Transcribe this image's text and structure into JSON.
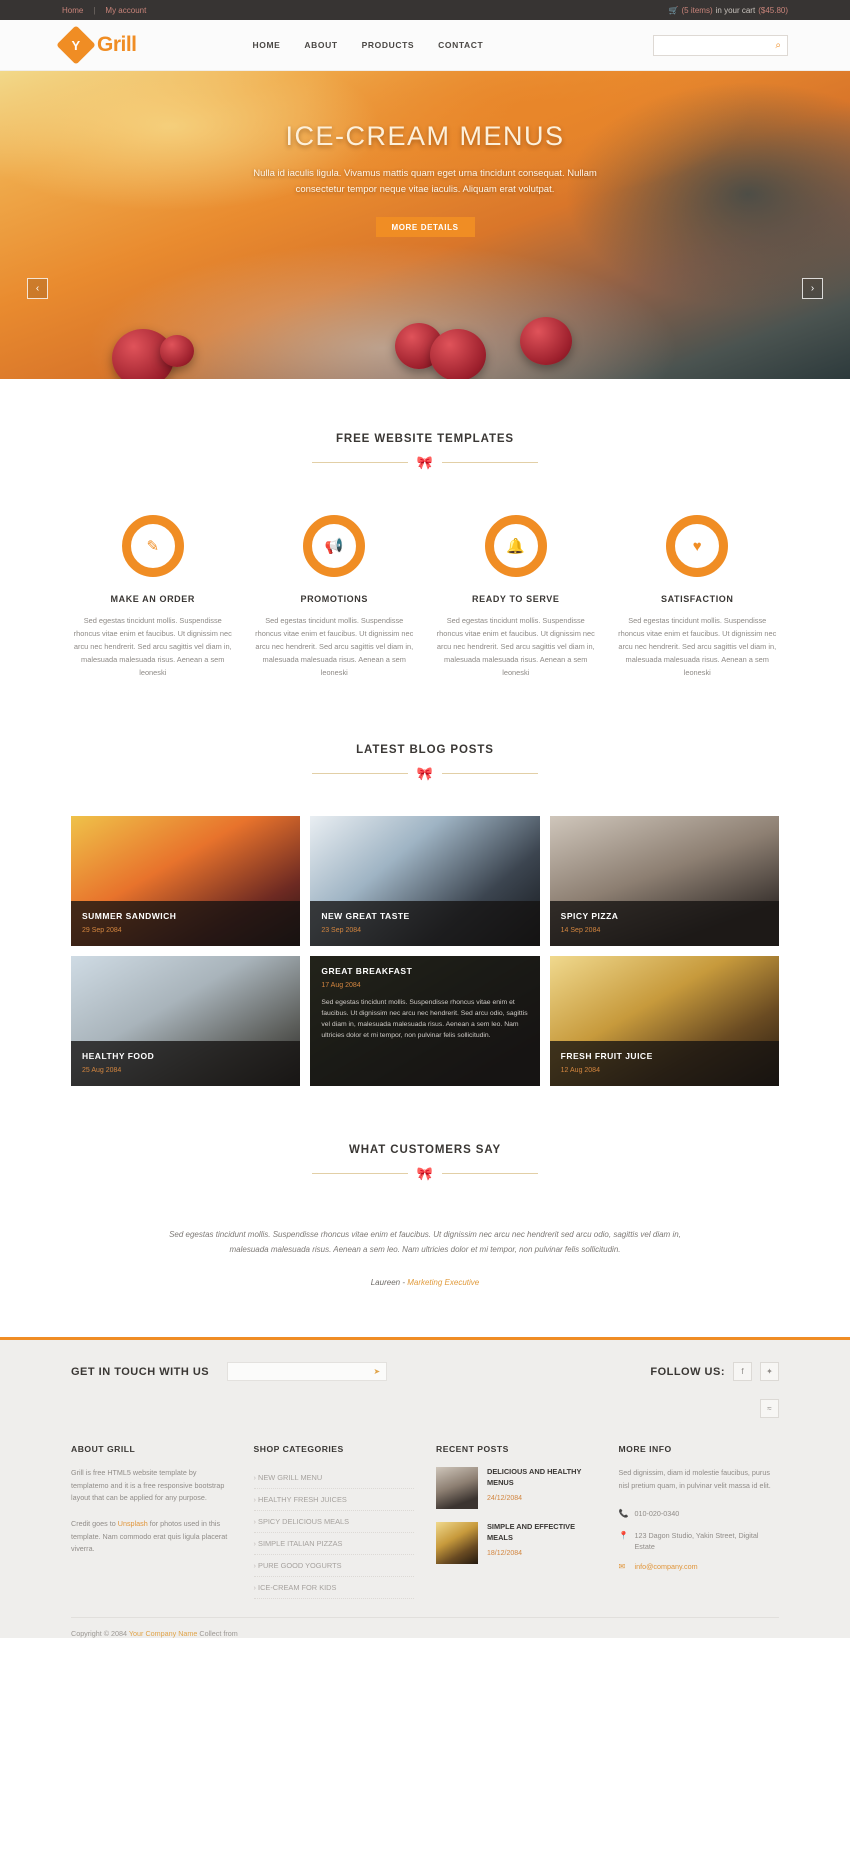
{
  "topbar": {
    "links": [
      {
        "label": "Home"
      },
      {
        "label": "My account"
      }
    ],
    "cart_icon": "cart-icon",
    "cart_items": "(5 items)",
    "cart_mid": "in your cart",
    "cart_total": "($45.80)"
  },
  "header": {
    "logo_glyph": "Y",
    "logo_text": "Grill",
    "nav": [
      {
        "label": "HOME"
      },
      {
        "label": "ABOUT"
      },
      {
        "label": "PRODUCTS"
      },
      {
        "label": "CONTACT"
      }
    ],
    "search_placeholder": "",
    "search_value": "",
    "search_icon": "search-icon"
  },
  "hero": {
    "title": "ICE-CREAM MENUS",
    "subtitle": "Nulla id iaculis ligula. Vivamus mattis quam eget urna tincidunt consequat. Nullam consectetur tempor neque vitae iaculis. Aliquam erat volutpat.",
    "button": "MORE DETAILS",
    "prev": "‹",
    "next": "›"
  },
  "features_section": {
    "title": "FREE WEBSITE TEMPLATES",
    "bow": "⚘",
    "items": [
      {
        "icon": "pencil-icon",
        "glyph": "✎",
        "title": "MAKE AN ORDER",
        "text": "Sed egestas tincidunt mollis. Suspendisse rhoncus vitae enim et faucibus. Ut dignissim nec arcu nec hendrerit. Sed arcu sagittis vel diam in, malesuada malesuada risus. Aenean a sem leoneski"
      },
      {
        "icon": "megaphone-icon",
        "glyph": "📣",
        "title": "PROMOTIONS",
        "text": "Sed egestas tincidunt mollis. Suspendisse rhoncus vitae enim et faucibus. Ut dignissim nec arcu nec hendrerit. Sed arcu sagittis vel diam in, malesuada malesuada risus. Aenean a sem leoneski"
      },
      {
        "icon": "bell-icon",
        "glyph": "🔔",
        "title": "READY TO SERVE",
        "text": "Sed egestas tincidunt mollis. Suspendisse rhoncus vitae enim et faucibus. Ut dignissim nec arcu nec hendrerit. Sed arcu sagittis vel diam in, malesuada malesuada risus. Aenean a sem leoneski"
      },
      {
        "icon": "heart-icon",
        "glyph": "♥",
        "title": "SATISFACTION",
        "text": "Sed egestas tincidunt mollis. Suspendisse rhoncus vitae enim et faucibus. Ut dignissim nec arcu nec hendrerit. Sed arcu sagittis vel diam in, malesuada malesuada risus. Aenean a sem leoneski"
      }
    ]
  },
  "blog_section": {
    "title": "LATEST BLOG POSTS",
    "bow": "⚘",
    "posts": [
      {
        "title": "SUMMER SANDWICH",
        "date": "29 Sep 2084",
        "excerpt": "",
        "img": "img-a"
      },
      {
        "title": "NEW GREAT TASTE",
        "date": "23 Sep 2084",
        "excerpt": "",
        "img": "img-b"
      },
      {
        "title": "SPICY PIZZA",
        "date": "14 Sep 2084",
        "excerpt": "",
        "img": "img-c"
      },
      {
        "title": "HEALTHY FOOD",
        "date": "25 Aug 2084",
        "excerpt": "",
        "img": "img-d"
      },
      {
        "title": "GREAT BREAKFAST",
        "date": "17 Aug 2084",
        "excerpt": "Sed egestas tincidunt mollis. Suspendisse rhoncus vitae enim et faucibus. Ut dignissim nec arcu nec hendrerit. Sed arcu odio, sagittis vel diam in, malesuada malesuada risus. Aenean a sem leo. Nam ultricies dolor et mi tempor, non pulvinar felis sollicitudin.",
        "img": "img-e"
      },
      {
        "title": "FRESH FRUIT JUICE",
        "date": "12 Aug 2084",
        "excerpt": "",
        "img": "img-f"
      }
    ]
  },
  "testimonial_section": {
    "title": "WHAT CUSTOMERS SAY",
    "bow": "⚘",
    "quote": "Sed egestas tincidunt mollis. Suspendisse rhoncus vitae enim et faucibus. Ut dignissim nec arcu nec hendrerit sed arcu odio, sagittis vel diam in, malesuada malesuada risus. Aenean a sem leo. Nam ultricies dolor et mi tempor, non pulvinar felis sollicitudin.",
    "author": "Laureen -",
    "role": " Marketing Executive"
  },
  "footer": {
    "get_in_touch": "GET IN TOUCH WITH US",
    "newsletter_placeholder": "",
    "newsletter_value": "",
    "newsletter_icon": "send-icon",
    "follow_label": "FOLLOW US:",
    "social": [
      {
        "icon": "facebook-icon",
        "glyph": "f"
      },
      {
        "icon": "twitter-icon",
        "glyph": "✦"
      },
      {
        "icon": "rss-icon",
        "glyph": "≈"
      }
    ],
    "about": {
      "title": "ABOUT GRILL",
      "p1": "Grill is free HTML5 website template by templatemo and it is a free responsive bootstrap layout that can be applied for any purpose.",
      "credit_pre": "Credit goes to ",
      "credit_link": "Unsplash",
      "credit_post": " for photos used in this template. Nam commodo erat quis ligula placerat viverra."
    },
    "categories": {
      "title": "SHOP CATEGORIES",
      "items": [
        "NEW GRILL MENU",
        "HEALTHY FRESH JUICES",
        "SPICY DELICIOUS MEALS",
        "SIMPLE ITALIAN PIZZAS",
        "PURE GOOD YOGURTS",
        "ICE-CREAM FOR KIDS"
      ]
    },
    "recent": {
      "title": "RECENT POSTS",
      "items": [
        {
          "title": "DELICIOUS AND HEALTHY MENUS",
          "date": "24/12/2084",
          "thumb": "img-c"
        },
        {
          "title": "SIMPLE AND EFFECTIVE MEALS",
          "date": "18/12/2084",
          "thumb": "img-f"
        }
      ]
    },
    "more_info": {
      "title": "MORE INFO",
      "text": "Sed dignissim, diam id molestie faucibus, purus nisl pretium quam, in pulvinar velit massa id elit.",
      "phone_icon": "phone-icon",
      "phone": "010-020-0340",
      "address_icon": "location-icon",
      "address": "123 Dagon Studio, Yakin Street, Digital Estate",
      "email_icon": "mail-icon",
      "email": "info@company.com"
    },
    "copyright_pre": "Copyright © 2084 ",
    "copyright_link": "Your Company Name",
    "copyright_post": " Collect from"
  }
}
